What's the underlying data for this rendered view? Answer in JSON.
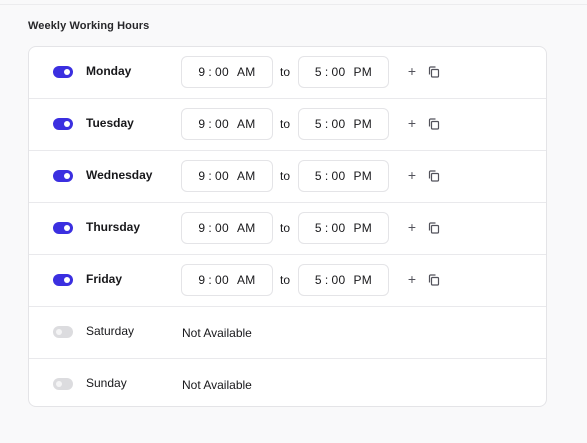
{
  "section": {
    "title": "Weekly Working Hours"
  },
  "colors": {
    "toggle_on": "#3b2fe0",
    "toggle_off": "#dcdcdf"
  },
  "labels": {
    "to": "to",
    "unavailable": "Not Available",
    "add_icon": "plus-icon",
    "copy_icon": "copy-icon"
  },
  "days": [
    {
      "name": "Monday",
      "enabled": true,
      "start": {
        "hour": "9",
        "minute": "00",
        "ampm": "AM"
      },
      "end": {
        "hour": "5",
        "minute": "00",
        "ampm": "PM"
      }
    },
    {
      "name": "Tuesday",
      "enabled": true,
      "start": {
        "hour": "9",
        "minute": "00",
        "ampm": "AM"
      },
      "end": {
        "hour": "5",
        "minute": "00",
        "ampm": "PM"
      }
    },
    {
      "name": "Wednesday",
      "enabled": true,
      "start": {
        "hour": "9",
        "minute": "00",
        "ampm": "AM"
      },
      "end": {
        "hour": "5",
        "minute": "00",
        "ampm": "PM"
      }
    },
    {
      "name": "Thursday",
      "enabled": true,
      "start": {
        "hour": "9",
        "minute": "00",
        "ampm": "AM"
      },
      "end": {
        "hour": "5",
        "minute": "00",
        "ampm": "PM"
      }
    },
    {
      "name": "Friday",
      "enabled": true,
      "start": {
        "hour": "9",
        "minute": "00",
        "ampm": "AM"
      },
      "end": {
        "hour": "5",
        "minute": "00",
        "ampm": "PM"
      }
    },
    {
      "name": "Saturday",
      "enabled": false
    },
    {
      "name": "Sunday",
      "enabled": false
    }
  ]
}
